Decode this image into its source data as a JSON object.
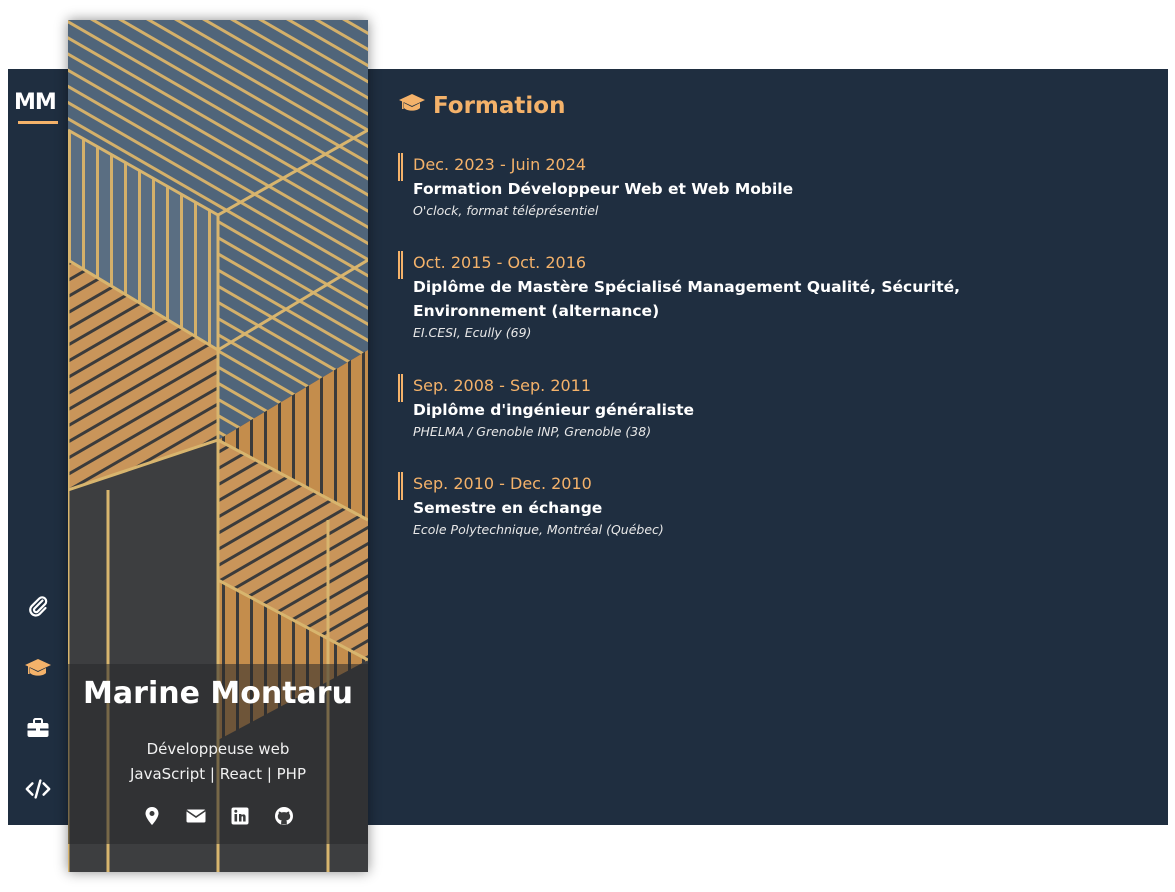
{
  "sidebar": {
    "logo": "MM",
    "nav_icons": [
      "paperclip-icon",
      "graduation-cap-icon",
      "briefcase-icon",
      "code-icon"
    ],
    "active_icon": "graduation-cap-icon"
  },
  "profile": {
    "name": "Marine Montaru",
    "role": "Développeuse web",
    "stack": "JavaScript | React | PHP",
    "contact_icons": [
      "location-icon",
      "email-icon",
      "linkedin-icon",
      "github-icon"
    ]
  },
  "section": {
    "title": "Formation",
    "icon": "graduation-cap-icon",
    "entries": [
      {
        "date": "Dec. 2023 - Juin 2024",
        "title": "Formation Développeur Web et Web Mobile",
        "school": "O'clock, format téléprésentiel"
      },
      {
        "date": "Oct. 2015 - Oct. 2016",
        "title": "Diplôme de Mastère Spécialisé Management Qualité, Sécurité, Environnement (alternance)",
        "school": "EI.CESI, Ecully (69)"
      },
      {
        "date": "Sep. 2008 - Sep. 2011",
        "title": "Diplôme d'ingénieur généraliste",
        "school": "PHELMA / Grenoble INP, Grenoble (38)"
      },
      {
        "date": "Sep. 2010 - Dec. 2010",
        "title": "Semestre en échange",
        "school": "Ecole Polytechnique, Montréal (Québec)"
      }
    ]
  },
  "colors": {
    "panel": "#1f2e40",
    "accent": "#f4b26a",
    "text": "#ffffff"
  }
}
